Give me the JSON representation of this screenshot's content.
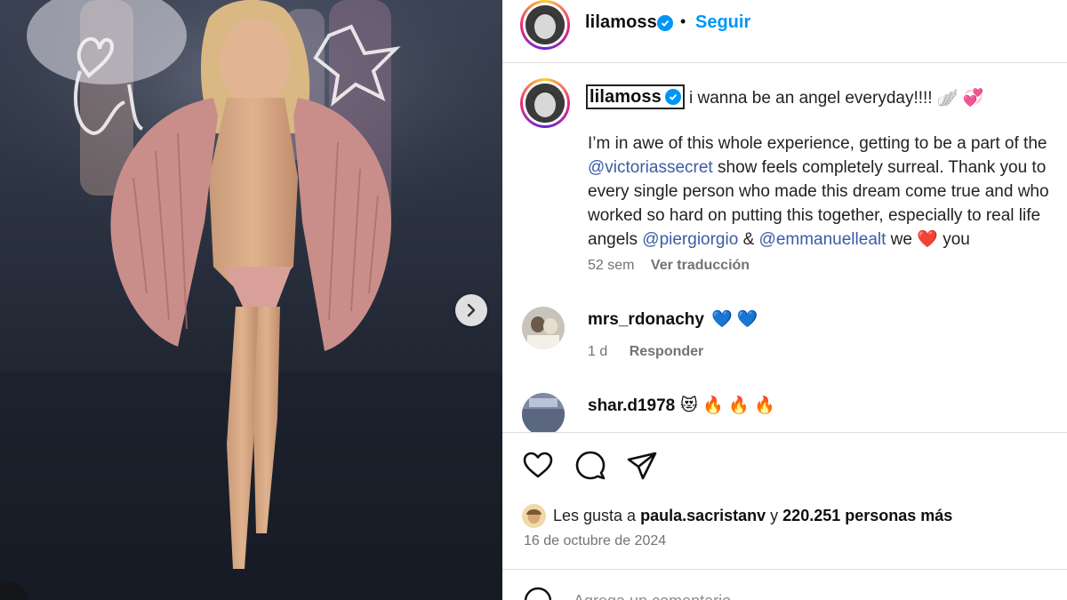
{
  "post": {
    "username": "lilamoss",
    "follow_label": "Seguir",
    "dot": "•"
  },
  "caption": {
    "username": "lilamoss",
    "first_line": "i wanna be an angel everyday!!!! 🪽 💞",
    "lines": [
      [
        "I’m in awe of this whole experience, getting to be a part of the"
      ],
      [
        "@victoriassecret",
        " show feels completely surreal. Thank you to"
      ],
      [
        "every single person who made this dream come true and who"
      ],
      [
        "worked so hard on putting this together, especially to real life"
      ],
      [
        "angels ",
        "@piergiorgio",
        " & ",
        "@emmanuellealt",
        " we ❤️ you"
      ]
    ],
    "line1": "I’m in awe of this whole experience, getting to be a part of the",
    "line2_mention": "@victoriassecret",
    "line2_rest": " show feels completely surreal. Thank you to",
    "line3": "every single person who made this dream come true and who",
    "line4": "worked so hard on putting this together, especially to real life",
    "line5_a": "angels ",
    "line5_m1": "@piergiorgio",
    "line5_b": " & ",
    "line5_m2": "@emmanuellealt",
    "line5_c": " we ",
    "line5_heart": "❤️",
    "line5_d": " you",
    "age": "52 sem",
    "translate": "Ver traducción"
  },
  "comments": [
    {
      "username": "mrs_rdonachy",
      "emoji": "💙 💙",
      "age": "1 d",
      "reply": "Responder"
    },
    {
      "username": "shar.d1978",
      "emoji": "😻 🔥 🔥 🔥"
    }
  ],
  "likes": {
    "prefix": "Les gusta a ",
    "user": "paula.sacristanv",
    "mid": " y ",
    "count": "220.251 personas más"
  },
  "date": "16 de octubre de 2024",
  "comment_placeholder": "Agrega un comentario...",
  "icons": [
    "chevron-right-icon",
    "verified-badge-icon",
    "heart-icon",
    "comment-icon",
    "share-icon",
    "emoji-icon"
  ],
  "colors": {
    "link": "#0095f6",
    "mention": "#3b5aa8",
    "muted": "#737373",
    "verified": "#0095f6"
  }
}
